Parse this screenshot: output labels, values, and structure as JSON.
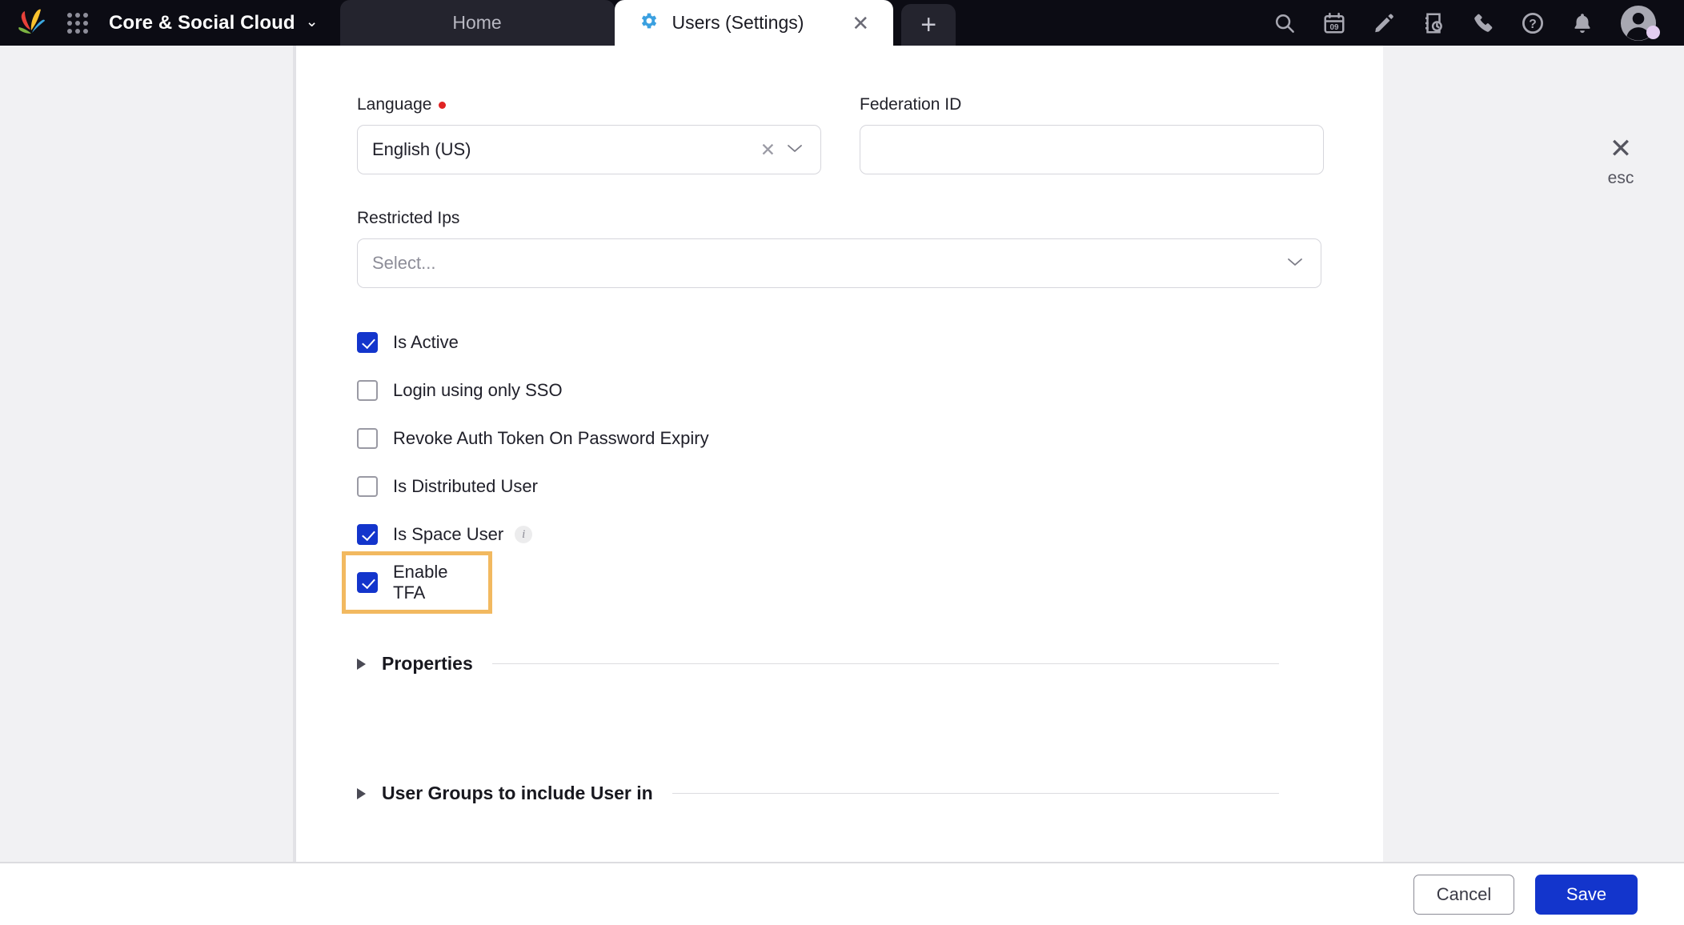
{
  "topbar": {
    "logo_icon": "leaf-logo-icon",
    "apps_icon": "app-grid-icon",
    "org_name": "Core & Social Cloud",
    "org_caret": "⌄",
    "tabs": [
      {
        "label": "Home",
        "icon": null,
        "active": false
      },
      {
        "label": "Users (Settings)",
        "icon": "gear-icon",
        "active": true,
        "close": "✕"
      }
    ],
    "add_tab_label": "+",
    "right_icons": [
      {
        "name": "search-icon"
      },
      {
        "name": "calendar-icon",
        "day": "09"
      },
      {
        "name": "pencil-icon"
      },
      {
        "name": "time-log-icon"
      },
      {
        "name": "phone-icon"
      },
      {
        "name": "help-icon"
      },
      {
        "name": "bell-icon"
      },
      {
        "name": "avatar-icon"
      }
    ]
  },
  "panel": {
    "esc": {
      "x": "✕",
      "label": "esc"
    },
    "fields": {
      "language": {
        "label": "Language",
        "required": true,
        "value": "English (US)",
        "clear": "✕",
        "caret": "⌄"
      },
      "federation_id": {
        "label": "Federation ID",
        "value": "",
        "placeholder": ""
      },
      "restricted_ips": {
        "label": "Restricted Ips",
        "value": "",
        "placeholder": "Select...",
        "caret": "⌄"
      }
    },
    "checkboxes": [
      {
        "label": "Is Active",
        "checked": true,
        "info": false,
        "highlighted": false
      },
      {
        "label": "Login using only SSO",
        "checked": false,
        "info": false,
        "highlighted": false
      },
      {
        "label": "Revoke Auth Token On Password Expiry",
        "checked": false,
        "info": false,
        "highlighted": false
      },
      {
        "label": "Is Distributed User",
        "checked": false,
        "info": false,
        "highlighted": false
      },
      {
        "label": "Is Space User",
        "checked": true,
        "info": true,
        "info_glyph": "i",
        "highlighted": false
      },
      {
        "label": "Enable TFA",
        "checked": true,
        "info": false,
        "highlighted": true
      }
    ],
    "sections": [
      {
        "title": "Properties",
        "expanded": false
      },
      {
        "title": "User Groups to include User in",
        "expanded": false
      }
    ]
  },
  "footer": {
    "cancel_label": "Cancel",
    "save_label": "Save"
  },
  "colors": {
    "topbar_bg": "#0c0c14",
    "tab_inactive_bg": "#24242e",
    "accent_blue": "#1335cc",
    "gear_blue": "#3ba0e0",
    "required_red": "#e02424",
    "highlight_orange": "#f2b960",
    "panel_bg": "#f1f1f3"
  }
}
